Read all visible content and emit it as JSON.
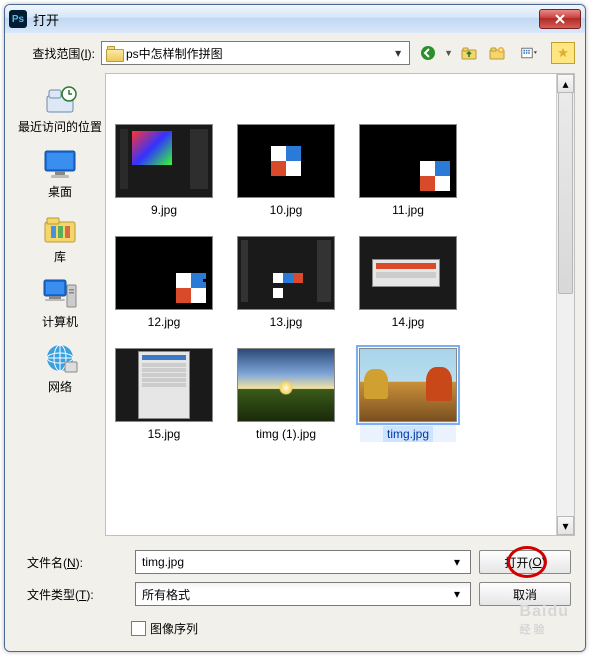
{
  "title": "打开",
  "lookin": {
    "label_pre": "查找范围(",
    "label_u": "I",
    "label_post": "):",
    "value": "ps中怎样制作拼图"
  },
  "toolbar": {
    "back": "back-icon",
    "up": "up-icon",
    "new": "new-folder-icon",
    "view": "view-icon",
    "star": "star-icon"
  },
  "places": [
    {
      "id": "recent",
      "label": "最近访问的位置"
    },
    {
      "id": "desktop",
      "label": "桌面"
    },
    {
      "id": "libraries",
      "label": "库"
    },
    {
      "id": "computer",
      "label": "计算机"
    },
    {
      "id": "network",
      "label": "网络"
    }
  ],
  "files": [
    {
      "name": "9.jpg",
      "kind": "ps-ui-palette"
    },
    {
      "name": "10.jpg",
      "kind": "squares-center"
    },
    {
      "name": "11.jpg",
      "kind": "squares-br"
    },
    {
      "name": "12.jpg",
      "kind": "puzzle"
    },
    {
      "name": "13.jpg",
      "kind": "ps-ui-sq"
    },
    {
      "name": "14.jpg",
      "kind": "dlg-small"
    },
    {
      "name": "15.jpg",
      "kind": "dlg-tall"
    },
    {
      "name": "timg (1).jpg",
      "kind": "sunset"
    },
    {
      "name": "timg.jpg",
      "kind": "painting",
      "selected": true
    }
  ],
  "filename": {
    "label_pre": "文件名(",
    "label_u": "N",
    "label_post": "):",
    "value": "timg.jpg"
  },
  "filetype": {
    "label_pre": "文件类型(",
    "label_u": "T",
    "label_post": "):",
    "value": "所有格式"
  },
  "buttons": {
    "open_pre": "打开(",
    "open_u": "O",
    "open_post": ")",
    "cancel": "取消"
  },
  "sequence": {
    "label": "图像序列"
  },
  "watermark": {
    "brand": "Baidu",
    "sub": "经验"
  }
}
